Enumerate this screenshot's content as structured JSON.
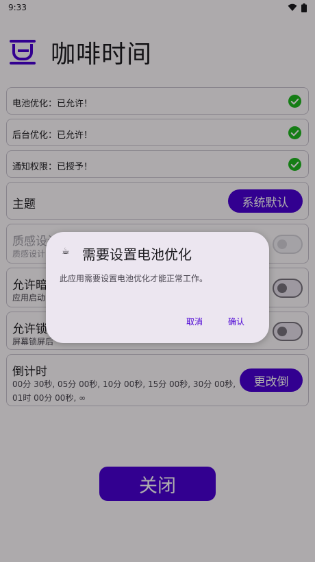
{
  "status_bar": {
    "time": "9:33"
  },
  "header": {
    "title": "咖啡时间"
  },
  "permissions": [
    {
      "label": "电池优化：已允许！"
    },
    {
      "label": "后台优化：已允许！"
    },
    {
      "label": "通知权限：已授予！"
    }
  ],
  "theme": {
    "title": "主题",
    "button": "系统默认"
  },
  "material": {
    "title": "质感设计",
    "sub": "质感设计"
  },
  "allow_dark": {
    "title": "允许暗",
    "sub": "应用启动"
  },
  "allow_lock": {
    "title": "允许锁",
    "sub": "屏幕锁屏后"
  },
  "timer": {
    "title": "倒计时",
    "values": "00分 30秒, 05分 00秒, 10分 00秒, 15分 00秒, 30分 00秒, 01时 00分 00秒, ∞",
    "button": "更改倒"
  },
  "close_button": "关闭",
  "dialog": {
    "title": "需要设置电池优化",
    "body": "此应用需要设置电池优化才能正常工作。",
    "cancel": "取消",
    "confirm": "确认"
  },
  "colors": {
    "accent": "#4a00d4",
    "check": "#1fb81f"
  }
}
